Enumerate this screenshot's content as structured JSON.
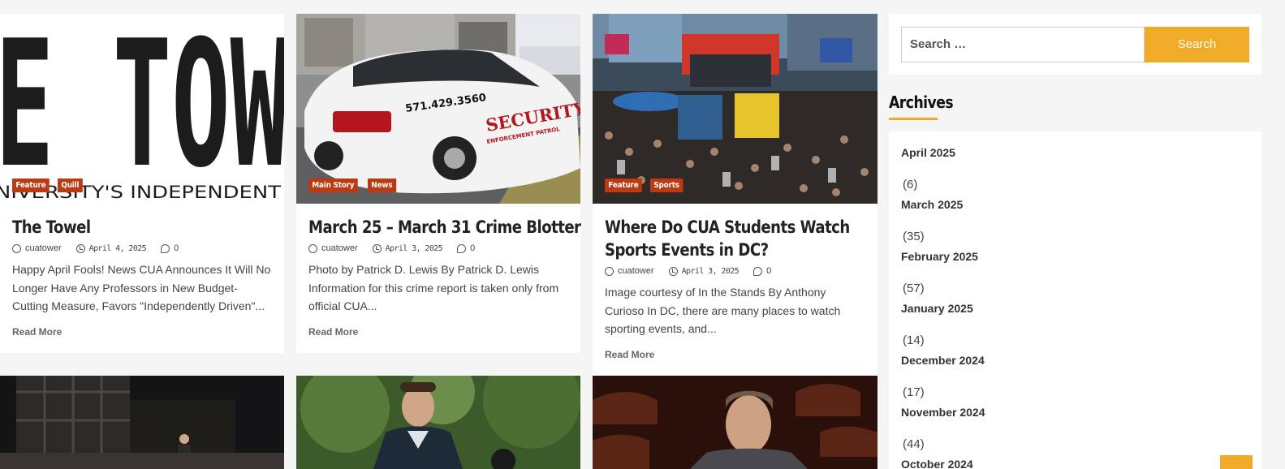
{
  "posts": [
    {
      "categories": [
        "Feature",
        "Quill"
      ],
      "title": "The Towel",
      "author": "cuatower",
      "date": "April 4, 2025",
      "comments": "0",
      "excerpt": "Happy April Fools! News CUA Announces It Will No Longer Have Any Professors in New Budget-Cutting Measure, Favors \"Independently Driven\"...",
      "read_more": "Read More",
      "image_text_top": "E TOW",
      "image_text_bottom": "NIVERSITY'S INDEPENDENT"
    },
    {
      "categories": [
        "Main Story",
        "News"
      ],
      "title": "March 25 – March 31 Crime Blotter",
      "author": "cuatower",
      "date": "April 3, 2025",
      "comments": "0",
      "excerpt": "Photo by Patrick D. Lewis By Patrick D. Lewis Information for this crime report is taken only from official CUA...",
      "read_more": "Read More",
      "car_phone": "571.429.3560",
      "car_word": "SECURITY",
      "car_sub": "ENFORCEMENT PATROL"
    },
    {
      "categories": [
        "Feature",
        "Sports"
      ],
      "title": "Where Do CUA Students Watch Sports Events in DC?",
      "author": "cuatower",
      "date": "April 3, 2025",
      "comments": "0",
      "excerpt": "Image courtesy of In the Stands By Anthony Curioso In DC, there are many places to watch sporting events, and...",
      "read_more": "Read More"
    }
  ],
  "search": {
    "placeholder": "Search …",
    "button": "Search"
  },
  "archives": {
    "title": "Archives",
    "items": [
      {
        "month": "April 2025",
        "count": "(6)"
      },
      {
        "month": "March 2025",
        "count": "(35)"
      },
      {
        "month": "February 2025",
        "count": "(57)"
      },
      {
        "month": "January 2025",
        "count": "(14)"
      },
      {
        "month": "December 2024",
        "count": "(17)"
      },
      {
        "month": "November 2024",
        "count": "(44)"
      },
      {
        "month": "October 2024",
        "count": ""
      }
    ]
  },
  "colors": {
    "accent": "#f0ab28",
    "category": "#bb3a11"
  }
}
